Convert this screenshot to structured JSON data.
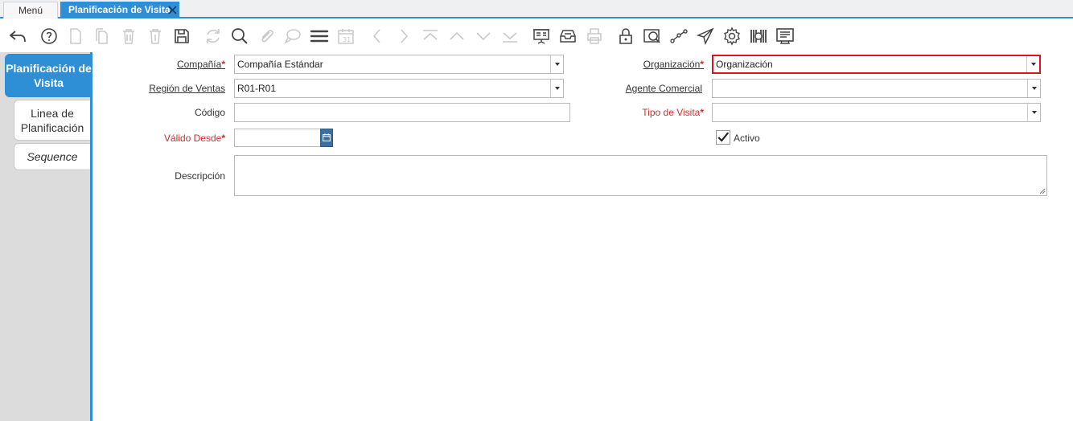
{
  "window_tabs": {
    "menu": "Menú (0)",
    "active": "Planificación de Visita"
  },
  "toolbar": {
    "icons": [
      "undo-icon",
      "help-icon",
      "new-record-icon",
      "copy-record-icon",
      "delete-icon",
      "delete-selection-icon",
      "save-icon",
      "refresh-icon",
      "find-icon",
      "attachment-icon",
      "chat-icon",
      "grid-toggle-icon",
      "calendar-icon",
      "previous-icon",
      "next-icon",
      "first-record-icon",
      "parent-record-icon",
      "detail-record-icon",
      "last-record-icon",
      "report-icon",
      "archive-icon",
      "print-icon",
      "lock-icon",
      "zoom-across-icon",
      "workflow-icon",
      "send-icon",
      "process-icon",
      "barcode-icon",
      "request-icon"
    ]
  },
  "detail_tabs": [
    {
      "label": "Planificación de Visita"
    },
    {
      "label": "Linea de Planificación"
    },
    {
      "label": "Sequence"
    }
  ],
  "form": {
    "company": {
      "label": "Compañía",
      "value": "Compañía Estándar"
    },
    "organization": {
      "label": "Organización",
      "value": "Organización"
    },
    "sales_region": {
      "label": "Región de Ventas",
      "value": "R01-R01"
    },
    "sales_rep": {
      "label": "Agente Comercial",
      "value": ""
    },
    "code": {
      "label": "Código",
      "value": ""
    },
    "visit_type": {
      "label": "Tipo de Visita",
      "value": ""
    },
    "valid_from": {
      "label": "Válido Desde",
      "value": ""
    },
    "active": {
      "label": "Activo",
      "checked": true
    },
    "description": {
      "label": "Descripción",
      "value": ""
    },
    "required_mark": "*"
  },
  "colors": {
    "accent": "#2f8fd6",
    "required": "#c9302c",
    "focus_border": "#d9161c"
  }
}
